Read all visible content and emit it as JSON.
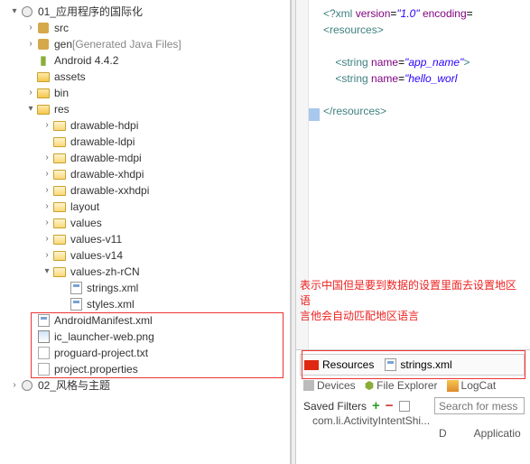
{
  "tree": {
    "root": "01_应用程序的国际化",
    "src": "src",
    "gen": "gen",
    "gen_hint": "[Generated Java Files]",
    "android": "Android 4.4.2",
    "assets": "assets",
    "bin": "bin",
    "res": "res",
    "drawable_hdpi": "drawable-hdpi",
    "drawable_ldpi": "drawable-ldpi",
    "drawable_mdpi": "drawable-mdpi",
    "drawable_xhdpi": "drawable-xhdpi",
    "drawable_xxhdpi": "drawable-xxhdpi",
    "layout": "layout",
    "values": "values",
    "values_v11": "values-v11",
    "values_v14": "values-v14",
    "values_zh_rcn": "values-zh-rCN",
    "strings_xml": "strings.xml",
    "styles_xml": "styles.xml",
    "manifest": "AndroidManifest.xml",
    "launcher": "ic_launcher-web.png",
    "proguard": "proguard-project.txt",
    "project_props": "project.properties",
    "root2": "02_风格与主题"
  },
  "editor": {
    "pi_open": "<?xml",
    "pi_version_attr": "version",
    "pi_version_val": "\"1.0\"",
    "pi_encoding_attr": "encoding",
    "res_open": "<resources>",
    "res_close": "</resources>",
    "string_tag": "<string",
    "name_attr": "name",
    "app_name_val": "\"app_name\"",
    "hello_val": "\"hello_worl",
    "close": ">"
  },
  "annotation": {
    "line1": "表示中国但是要到数据的设置里面去设置地区语",
    "line2": "言他会自动匹配地区语言"
  },
  "bottom": {
    "resources": "Resources",
    "strings": "strings.xml"
  },
  "toolbar": {
    "devices": "Devices",
    "file_explorer": "File Explorer",
    "logcat": "LogCat"
  },
  "filters": {
    "label": "Saved Filters",
    "search_ph": "Search for mess"
  },
  "table": {
    "activity": "com.li.ActivityIntentShi...",
    "col_d": "D",
    "col_app": "Applicatio"
  }
}
